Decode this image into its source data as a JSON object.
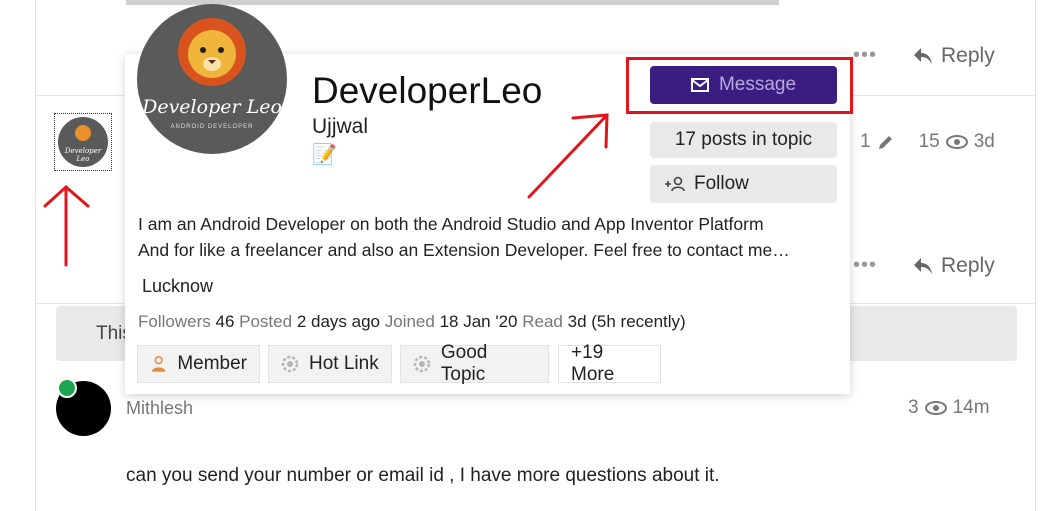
{
  "post_top": {
    "reply_label": "Reply"
  },
  "post_leo": {
    "meta_edits": "1",
    "meta_views": "15",
    "meta_age": "3d",
    "reply_label": "Reply"
  },
  "notice": {
    "text_prefix": "This"
  },
  "user_card": {
    "username": "DeveloperLeo",
    "name": "Ujjwal",
    "status_emoji": "📝",
    "avatar_text": "Developer Leo",
    "avatar_subtext": "ANDROID DEVELOPER",
    "message_label": "Message",
    "posts_label": "17 posts in topic",
    "follow_label": "Follow",
    "bio_line1": "I am an Android Developer on both the Android Studio and App Inventor Platform",
    "bio_line2": "And for like a freelancer and also an Extension Developer. Feel free to contact me…",
    "location": "Lucknow",
    "stats": {
      "followers_label": "Followers",
      "followers_value": "46",
      "posted_label": "Posted",
      "posted_value": "2 days ago",
      "joined_label": "Joined",
      "joined_value": "18 Jan '20",
      "read_label": "Read",
      "read_value": "3d (5h recently)"
    },
    "badges": [
      {
        "label": "Member",
        "icon": "user-icon"
      },
      {
        "label": "Hot Link",
        "icon": "gear-badge-icon"
      },
      {
        "label": "Good Topic",
        "icon": "gear-badge-icon"
      },
      {
        "label": "+19 More"
      }
    ]
  },
  "post_mithlesh": {
    "username": "Mithlesh",
    "meta_views": "3",
    "meta_age": "14m",
    "body": "can you send your number or email id , I have more questions about it."
  },
  "colors": {
    "message_button": "#3b1d82",
    "annotation_red": "#e0161c",
    "avatar_bg": "#5a5a5a",
    "online_dot": "#1ca551"
  }
}
